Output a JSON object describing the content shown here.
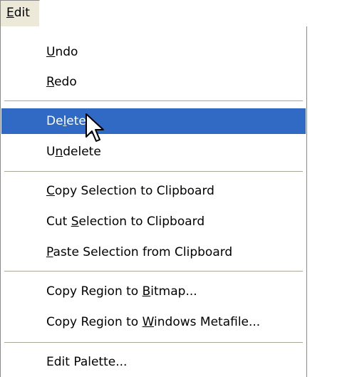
{
  "menubar": {
    "edit": {
      "pre": "",
      "acc": "E",
      "post": "dit"
    }
  },
  "menu": {
    "undo": {
      "pre": "",
      "acc": "U",
      "post": "ndo"
    },
    "redo": {
      "pre": "",
      "acc": "R",
      "post": "edo"
    },
    "delete": {
      "pre": "De",
      "acc": "l",
      "post": "ete"
    },
    "undelete": {
      "pre": "U",
      "acc": "n",
      "post": "delete"
    },
    "copy_selection": {
      "pre": "",
      "acc": "C",
      "post": "opy Selection to Clipboard"
    },
    "cut_selection": {
      "pre": "Cut ",
      "acc": "S",
      "post": "election to Clipboard"
    },
    "paste_selection": {
      "pre": "",
      "acc": "P",
      "post": "aste Selection from Clipboard"
    },
    "copy_region_bitmap": {
      "pre": "Copy Region to ",
      "acc": "B",
      "post": "itmap..."
    },
    "copy_region_metafile": {
      "pre": "Copy Region to ",
      "acc": "W",
      "post": "indows Metafile..."
    },
    "edit_palette": {
      "pre": "Edit Palette...",
      "acc": "",
      "post": ""
    }
  },
  "colors": {
    "selection": "#316ac5",
    "menu_bg": "#ffffff",
    "menubar_bg": "#ece9d8"
  },
  "icons": {
    "cursor": "arrow-cursor-icon"
  }
}
